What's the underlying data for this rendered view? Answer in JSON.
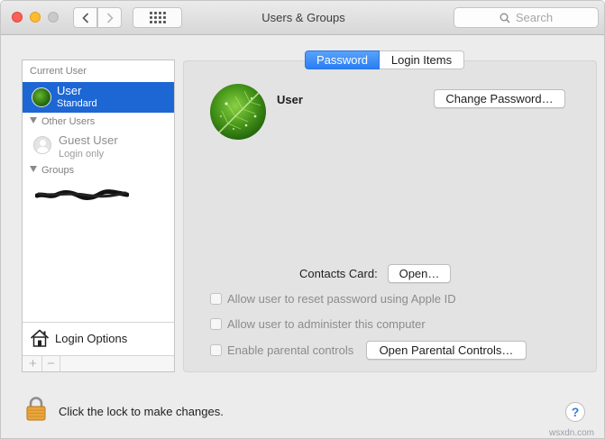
{
  "window": {
    "title": "Users & Groups"
  },
  "toolbar": {
    "back_icon": "chevron-left-icon",
    "forward_icon": "chevron-right-icon",
    "show_all_icon": "grid-icon",
    "search_placeholder": "Search"
  },
  "sidebar": {
    "current_user_header": "Current User",
    "current_user": {
      "name": "User",
      "role": "Standard"
    },
    "other_users_header": "Other Users",
    "guest": {
      "name": "Guest User",
      "status": "Login only"
    },
    "groups_header": "Groups",
    "login_options_label": "Login Options",
    "add_label": "+",
    "remove_label": "−"
  },
  "tabs": [
    {
      "label": "Password",
      "active": true
    },
    {
      "label": "Login Items",
      "active": false
    }
  ],
  "panel": {
    "user_name": "User",
    "change_password_label": "Change Password…",
    "contacts_card_label": "Contacts Card:",
    "open_label": "Open…",
    "checkboxes": [
      {
        "label": "Allow user to reset password using Apple ID",
        "checked": false,
        "enabled": false
      },
      {
        "label": "Allow user to administer this computer",
        "checked": false,
        "enabled": false
      },
      {
        "label": "Enable parental controls",
        "checked": false,
        "enabled": false
      }
    ],
    "open_parental_label": "Open Parental Controls…"
  },
  "footer": {
    "lock_label": "Click the lock to make changes.",
    "help_label": "?"
  },
  "watermark": "wsxdn.com",
  "colors": {
    "selection": "#1d67d4",
    "tab_active": "#2a7ef5",
    "close": "#fc5f57",
    "minimize": "#fdbc2e",
    "maximize": "#c9c9c9"
  }
}
